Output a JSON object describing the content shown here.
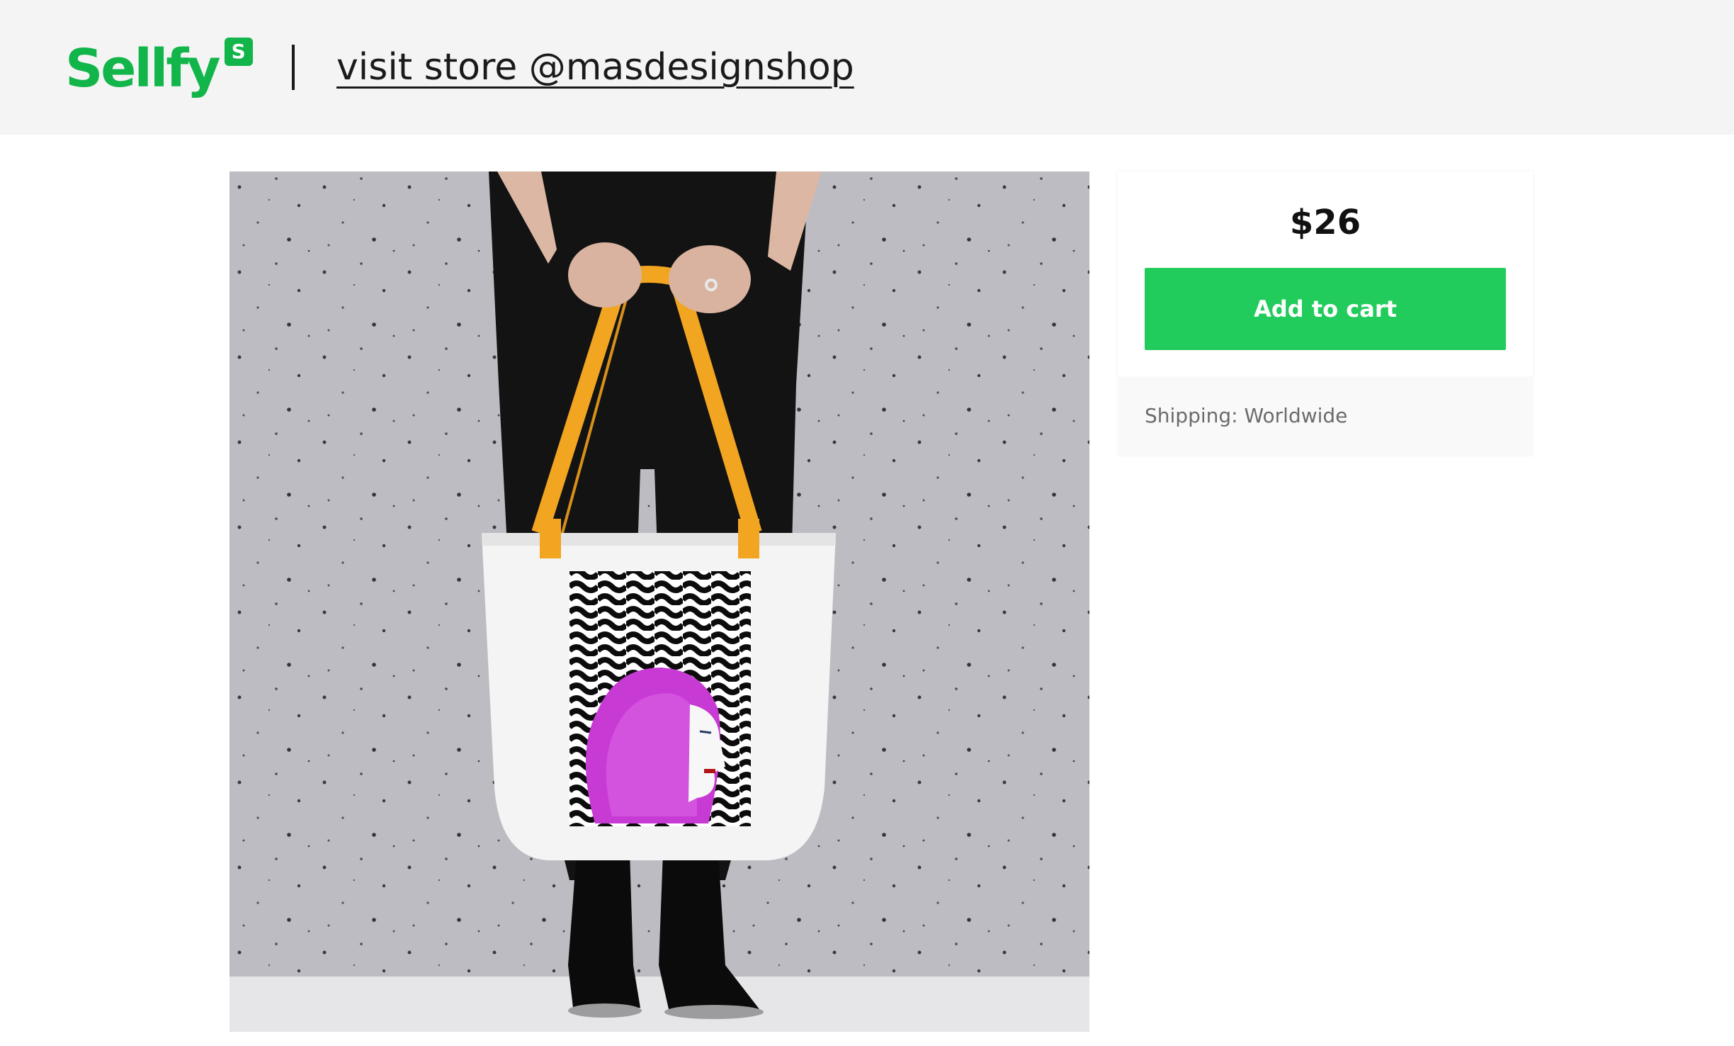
{
  "header": {
    "brand_name": "Sellfy",
    "brand_badge": "S",
    "store_link_text": "visit store @masdesignshop"
  },
  "product": {
    "image_alt": "Tote bag with orange handles and pink-haired woman illustration on black-and-white wavy pattern",
    "price": "$26",
    "add_to_cart_label": "Add to cart",
    "shipping_text": "Shipping: Worldwide"
  },
  "colors": {
    "brand_green": "#12b54a",
    "cta_green": "#22cc5c",
    "header_bg": "#f4f4f4"
  }
}
